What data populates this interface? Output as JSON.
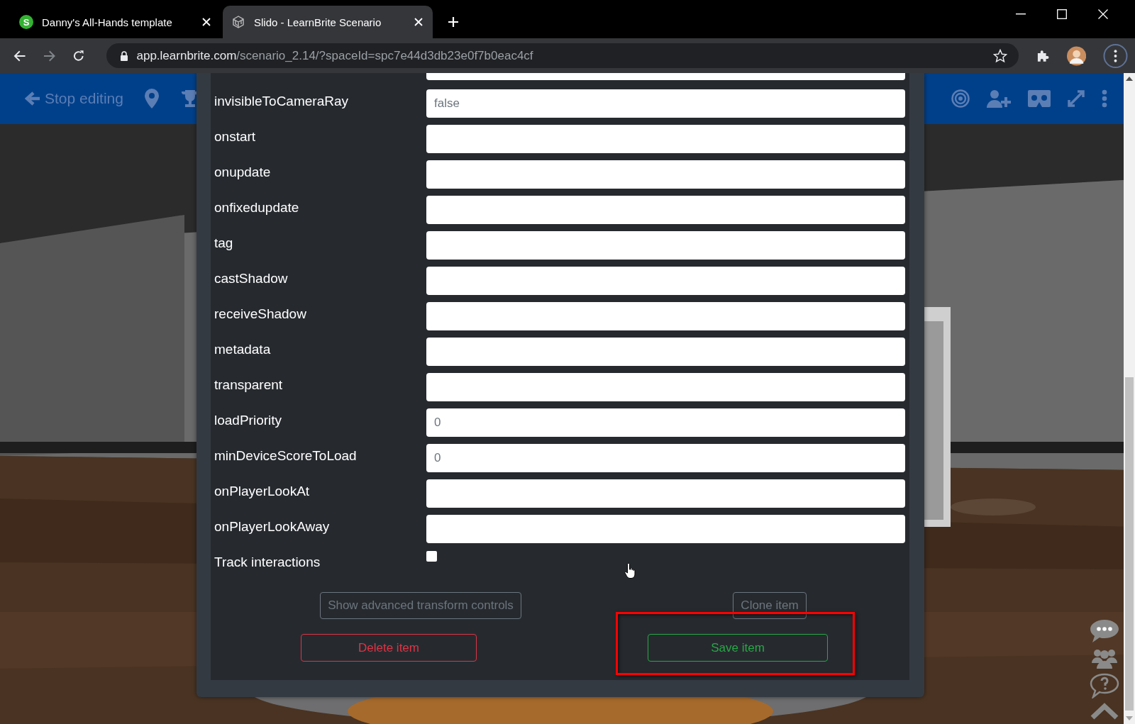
{
  "browser": {
    "tabs": [
      {
        "title": "Danny's All-Hands template",
        "favicon_letter": "S",
        "selected": false
      },
      {
        "title": "Slido - LearnBrite Scenario",
        "selected": true
      }
    ],
    "address": {
      "host": "app.learnbrite.com",
      "path": "/scenario_2.14/?spaceId=spc7e44d3db23e0f7b0eac4cf"
    }
  },
  "app_bar": {
    "back_label": "Stop editing"
  },
  "item_editor": {
    "fields": [
      {
        "label": "invisibleToCameraRay",
        "kind": "text",
        "placeholder": "false"
      },
      {
        "label": "onstart",
        "kind": "text"
      },
      {
        "label": "onupdate",
        "kind": "text"
      },
      {
        "label": "onfixedupdate",
        "kind": "text"
      },
      {
        "label": "tag",
        "kind": "text"
      },
      {
        "label": "castShadow",
        "kind": "text"
      },
      {
        "label": "receiveShadow",
        "kind": "text"
      },
      {
        "label": "metadata",
        "kind": "text"
      },
      {
        "label": "transparent",
        "kind": "text"
      },
      {
        "label": "loadPriority",
        "kind": "text",
        "placeholder": "0"
      },
      {
        "label": "minDeviceScoreToLoad",
        "kind": "text",
        "placeholder": "0"
      },
      {
        "label": "onPlayerLookAt",
        "kind": "text"
      },
      {
        "label": "onPlayerLookAway",
        "kind": "text"
      },
      {
        "label": "Track interactions",
        "kind": "checkbox",
        "checked": false
      }
    ],
    "buttons": [
      {
        "label": "Show advanced transform controls",
        "kind": "secondary",
        "highlighted": false
      },
      {
        "label": "Clone item",
        "kind": "secondary",
        "highlighted": false
      },
      {
        "label": "Delete item",
        "kind": "danger",
        "highlighted": false
      },
      {
        "label": "Save item",
        "kind": "success",
        "highlighted": true
      }
    ]
  }
}
